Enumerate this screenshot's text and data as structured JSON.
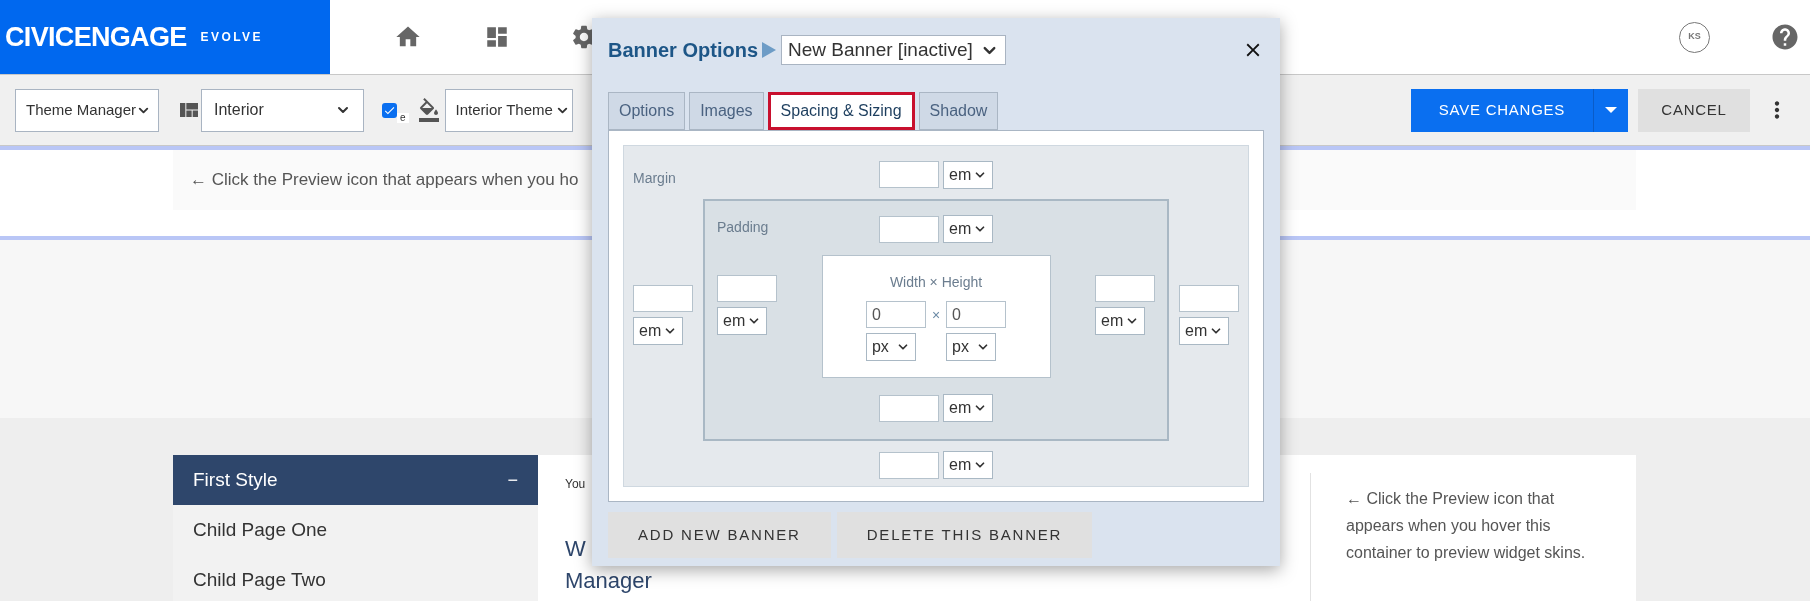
{
  "header": {
    "logo": "CIVICENGAGE",
    "logo_suffix": "EVOLVE",
    "avatar_initials": "KS"
  },
  "toolbar": {
    "section_select": "Theme Manager",
    "layout_select": "Interior",
    "checkbox": {
      "checked": true,
      "label": "e"
    },
    "theme_select": "Interior Theme",
    "save_button": "SAVE CHANGES",
    "cancel_button": "CANCEL"
  },
  "banner_hint": "← Click the Preview icon that appears when you ho",
  "sidebar": {
    "title": "First Style",
    "toggle": "−",
    "items": [
      "Child Page One",
      "Child Page Two"
    ]
  },
  "main": {
    "breadcrumb": "You",
    "heading_lines": [
      "W",
      "Manager"
    ]
  },
  "aside": {
    "text": "← Click the Preview icon that appears when you hover this container to preview widget skins."
  },
  "dialog": {
    "title": "Banner Options",
    "banner_select": "New Banner [inactive]",
    "tabs": [
      {
        "label": "Options",
        "selected": false
      },
      {
        "label": "Images",
        "selected": false
      },
      {
        "label": "Spacing & Sizing",
        "selected": true
      },
      {
        "label": "Shadow",
        "selected": false
      }
    ],
    "margin": {
      "label": "Margin",
      "top": {
        "unit": "em"
      },
      "left": {
        "unit": "em"
      },
      "right": {
        "unit": "em"
      },
      "bottom": {
        "unit": "em"
      }
    },
    "padding": {
      "label": "Padding",
      "top": {
        "unit": "em"
      },
      "left": {
        "unit": "em"
      },
      "right": {
        "unit": "em"
      },
      "bottom": {
        "unit": "em"
      }
    },
    "size": {
      "label": "Width × Height",
      "separator": "×",
      "width": {
        "value": "0",
        "unit": "px"
      },
      "height": {
        "value": "0",
        "unit": "px"
      }
    },
    "buttons": [
      "ADD NEW BANNER",
      "DELETE THIS BANNER"
    ]
  }
}
